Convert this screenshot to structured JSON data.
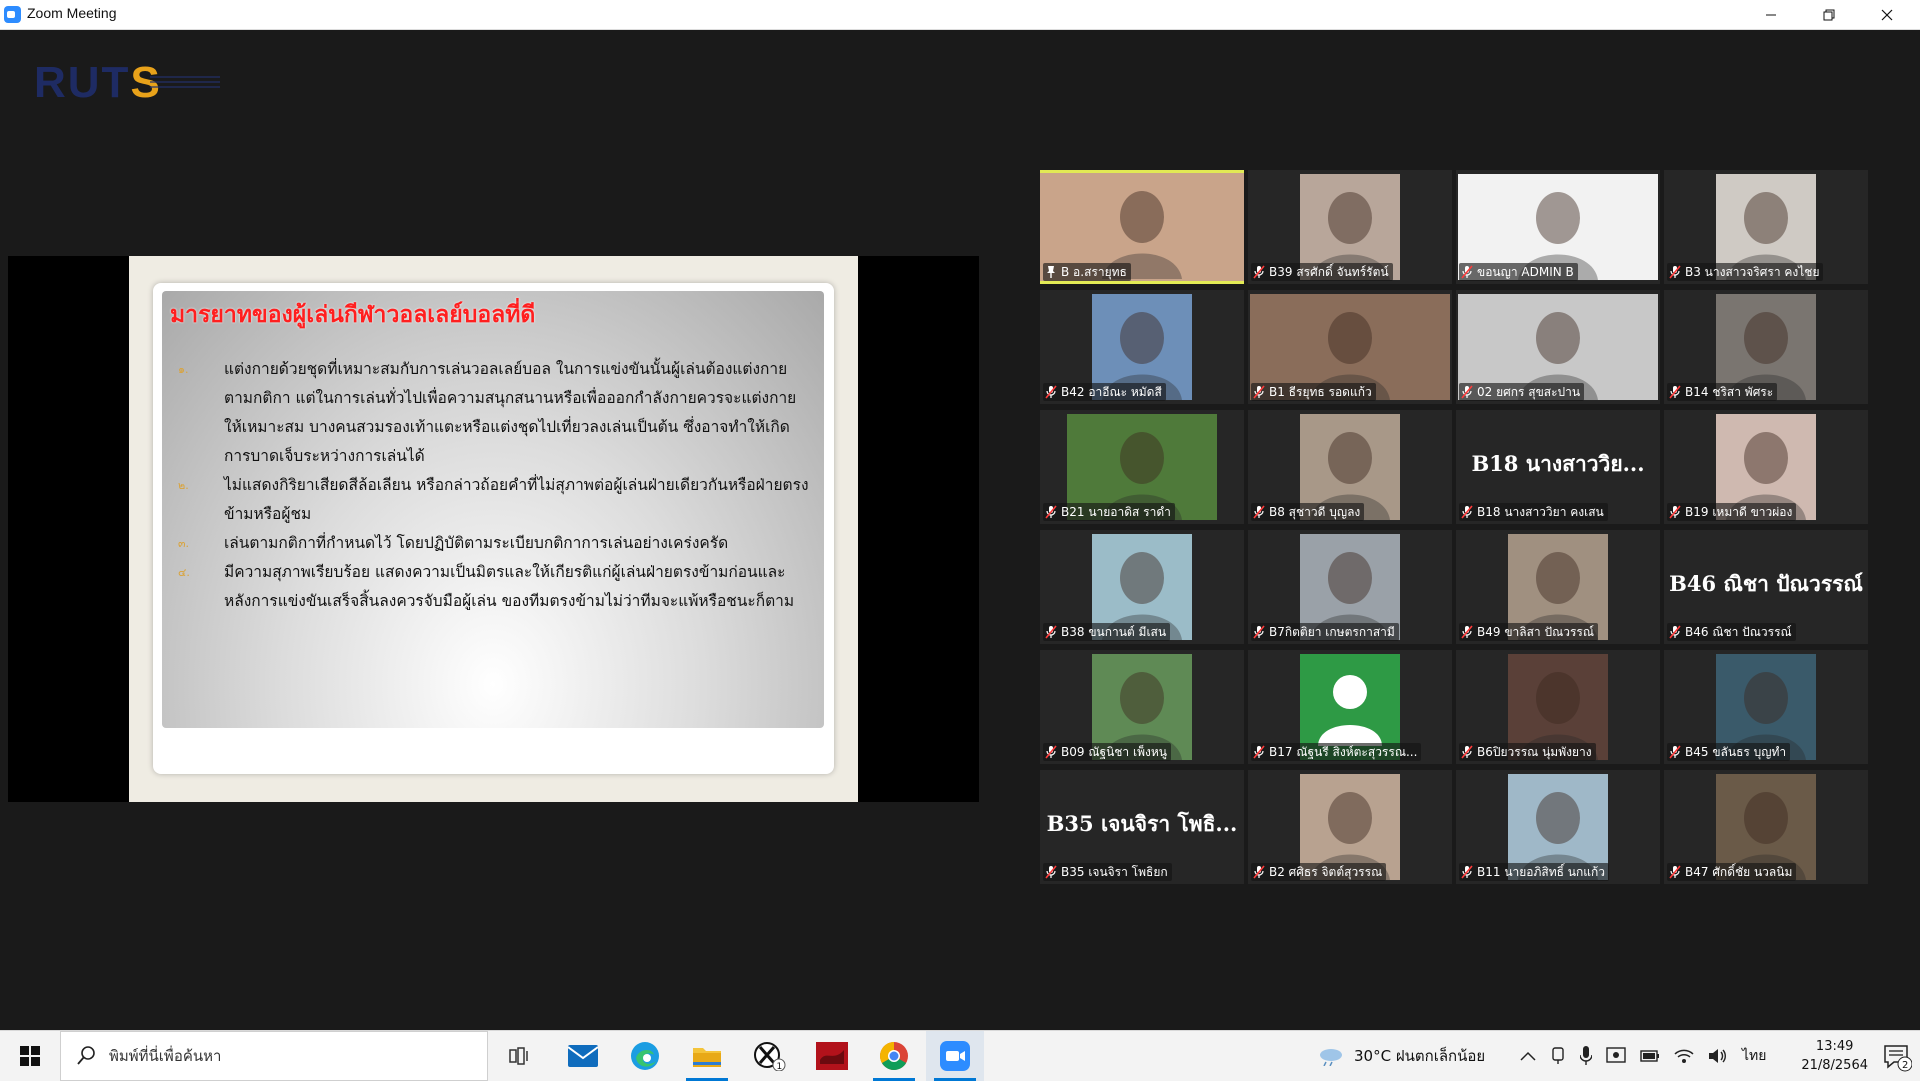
{
  "window": {
    "title": "Zoom Meeting",
    "icon": "zoom-icon",
    "controls": [
      "minimize-icon",
      "restore-icon",
      "close-icon"
    ]
  },
  "logo": {
    "text_a": "RUT",
    "text_b": "S"
  },
  "slide": {
    "title": "มารยาทของผู้เล่นกีฬาวอลเลย์บอลที่ดี",
    "bullets": [
      {
        "num": "๑.",
        "text": "แต่งกายด้วยชุดที่เหมาะสมกับการเล่นวอลเลย์บอล ในการแข่งขันนั้นผู้เล่นต้องแต่งกายตามกติกา แต่ในการเล่นทั่วไปเพื่อความสนุกสนานหรือเพื่อออกกำลังกายควรจะแต่งกายให้เหมาะสม บางคนสวมรองเท้าแตะหรือแต่งชุดไปเที่ยวลงเล่นเป็นต้น ซึ่งอาจทำให้เกิดการบาดเจ็บระหว่างการเล่นได้"
      },
      {
        "num": "๒.",
        "text": "ไม่แสดงกิริยาเสียดสีล้อเลียน หรือกล่าวถ้อยคำที่ไม่สุภาพต่อผู้เล่นฝ่ายเดียวกันหรือฝ่ายตรงข้ามหรือผู้ชม"
      },
      {
        "num": "๓.",
        "text": "เล่นตามกติกาที่กำหนดไว้ โดยปฏิบัติตามระเบียบกติกาการเล่นอย่างเคร่งครัด"
      },
      {
        "num": "๔.",
        "text": "มีความสุภาพเรียบร้อย แสดงความเป็นมิตรและให้เกียรติแก่ผู้เล่นฝ่ายตรงข้ามก่อนและ หลังการแข่งขันเสร็จสิ้นลงควรจับมือผู้เล่น ของทีมตรงข้ามไม่ว่าทีมจะแพ้หรือชนะก็ตาม"
      }
    ]
  },
  "participants": [
    {
      "name": "B อ.สรายุทธ",
      "video": true,
      "pinned": true,
      "active": true,
      "bg": "#c9a48a"
    },
    {
      "name": "B39 สรศักดิ์ จันทร์รัตน์",
      "video": true,
      "bg": "#b8a69a"
    },
    {
      "name": "ขอนญา ADMIN B",
      "video": true,
      "bg": "#f2f2f2"
    },
    {
      "name": "B3 นางสาวจริศรา คงไชย",
      "video": true,
      "bg": "#cfcac4"
    },
    {
      "name": "B42 อาอีณะ หมัดสี",
      "video": true,
      "bg": "#6d8fb8"
    },
    {
      "name": "B1 ธีรยุทธ รอดแก้ว",
      "video": true,
      "bg": "#8a6d5a"
    },
    {
      "name": "02 ยศกร สุขสะปาน",
      "video": true,
      "bg": "#c8c8c8"
    },
    {
      "name": "B14 ชริสา พัศระ",
      "video": true,
      "bg": "#7a7570"
    },
    {
      "name": "B21 นายอาดิส ราดำ",
      "video": true,
      "bg": "#4f7a3a"
    },
    {
      "name": "B8 สุชาวดี บุญลง",
      "video": true,
      "bg": "#a89888"
    },
    {
      "name": "B18 นางสาววิยา คงเสน",
      "video": false,
      "display": "B18 นางสาววิย..."
    },
    {
      "name": "B19 เหมาดี ขาวผ่อง",
      "video": true,
      "bg": "#cfb9b0"
    },
    {
      "name": "B38 ขนกานต์ มีเสน",
      "video": true,
      "bg": "#9bbcc8"
    },
    {
      "name": "B7กิตติยา เกษตรกาสามี",
      "video": true,
      "bg": "#9aa1a8"
    },
    {
      "name": "B49 ขาลิสา ปัณวรรณ์",
      "video": true,
      "bg": "#a09080"
    },
    {
      "name": "B46 ณิชา ปัณวรรณ์",
      "video": false,
      "display": "B46 ณิชา ปัณวรรณ์"
    },
    {
      "name": "B09 ณัฐนิชา เพ็งหนู",
      "video": true,
      "bg": "#5f8a55"
    },
    {
      "name": "B17 ณัฐนรี สิงห์ตะสุวรรณ...",
      "video": true,
      "avatar": true,
      "bg": "#2e9a45"
    },
    {
      "name": "B6ปิยวรรณ นุ่มพังยาง",
      "video": true,
      "bg": "#5a4038"
    },
    {
      "name": "B45 ขลันธร บุญทำ",
      "video": true,
      "bg": "#3a5a6a"
    },
    {
      "name": "B35 เจนจิรา โพธิยก",
      "video": false,
      "display": "B35 เจนจิรา โพธิ..."
    },
    {
      "name": "B2 ศศิธร จิตต์สุวรรณ",
      "video": true,
      "bg": "#b8a290"
    },
    {
      "name": "B11 นายอภิสิทธิ์ นกแก้ว",
      "video": true,
      "bg": "#9fb8c8"
    },
    {
      "name": "B47 ศักดิ์ชัย นวลนิม",
      "video": true,
      "bg": "#6a5a48"
    }
  ],
  "taskbar": {
    "search_placeholder": "พิมพ์ที่นี่เพื่อค้นหา",
    "pinned_apps": [
      "task-view-icon",
      "mail-icon",
      "edge-icon",
      "file-explorer-icon",
      "xbox-icon",
      "app-red-icon",
      "chrome-icon",
      "zoom-icon"
    ],
    "xbox_badge": "1",
    "weather": "30°C ฝนตกเล็กน้อย",
    "language": "ไทย",
    "time": "13:49",
    "date": "21/8/2564",
    "notification_count": "2"
  }
}
